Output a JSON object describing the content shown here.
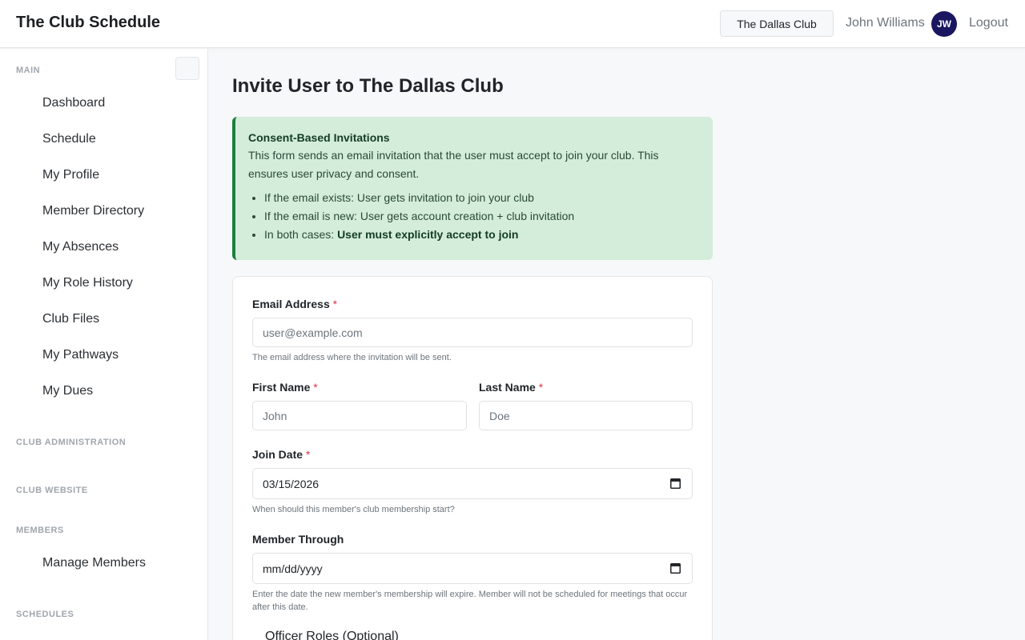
{
  "header": {
    "brand": "The Club Schedule",
    "club_selector": "The Dallas Club",
    "user_name": "John Williams",
    "avatar_initials": "JW",
    "logout": "Logout"
  },
  "sidebar": {
    "sections": {
      "main": "MAIN",
      "club_admin": "CLUB ADMINISTRATION",
      "club_website": "CLUB WEBSITE",
      "members": "MEMBERS",
      "schedules": "SCHEDULES"
    },
    "main_items": [
      "Dashboard",
      "Schedule",
      "My Profile",
      "Member Directory",
      "My Absences",
      "My Role History",
      "Club Files",
      "My Pathways",
      "My Dues"
    ],
    "members_items": [
      "Manage Members"
    ]
  },
  "page": {
    "title": "Invite User to The Dallas Club"
  },
  "alert": {
    "title": "Consent-Based Invitations",
    "text": "This form sends an email invitation that the user must accept to join your club. This ensures user privacy and consent.",
    "bullet1": "If the email exists: User gets invitation to join your club",
    "bullet2": "If the email is new: User gets account creation + club invitation",
    "bullet3_prefix": "In both cases: ",
    "bullet3_strong": "User must explicitly accept to join"
  },
  "form": {
    "required_mark": "*",
    "email": {
      "label": "Email Address",
      "placeholder": "user@example.com",
      "help": "The email address where the invitation will be sent."
    },
    "first_name": {
      "label": "First Name",
      "placeholder": "John"
    },
    "last_name": {
      "label": "Last Name",
      "placeholder": "Doe"
    },
    "join_date": {
      "label": "Join Date",
      "value": "03/15/2026",
      "help": "When should this member's club membership start?"
    },
    "member_through": {
      "label": "Member Through",
      "placeholder": "mm/dd/yyyy",
      "help": "Enter the date the new member's membership will expire. Member will not be scheduled for meetings that occur after this date."
    },
    "officer_roles_legend": "Officer Roles (Optional)"
  },
  "colors": {
    "avatar_bg": "#1a1660",
    "alert_bg": "#d4eddb",
    "alert_border": "#1d7f3d",
    "required": "#dc3545"
  }
}
